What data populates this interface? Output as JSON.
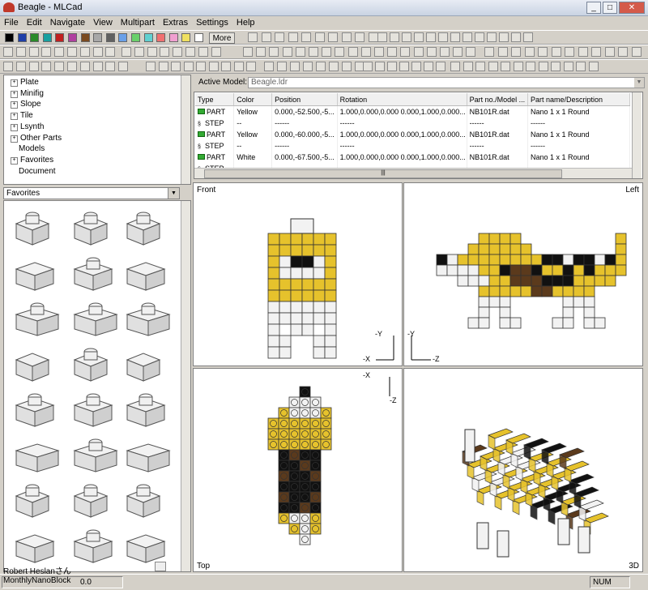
{
  "window": {
    "title": "Beagle - MLCad",
    "controls": [
      "minimize",
      "maximize",
      "close"
    ]
  },
  "menu": [
    "File",
    "Edit",
    "Navigate",
    "View",
    "Multipart",
    "Extras",
    "Settings",
    "Help"
  ],
  "toolbar": {
    "color_swatches": [
      "#000000",
      "#1f3fa8",
      "#2a8a2a",
      "#18a0a0",
      "#c02020",
      "#b040a0",
      "#7a4a20",
      "#a8a8a8",
      "#606060",
      "#6aa0e8",
      "#6ad06a",
      "#60d0d0",
      "#f07070",
      "#f0a0d0",
      "#f0e060",
      "#ffffff"
    ],
    "more_label": "More"
  },
  "tree": {
    "items": [
      {
        "label": "Plate",
        "expandable": true
      },
      {
        "label": "Minifig",
        "expandable": true
      },
      {
        "label": "Slope",
        "expandable": true
      },
      {
        "label": "Tile",
        "expandable": true
      },
      {
        "label": "Lsynth",
        "expandable": true
      },
      {
        "label": "Other Parts",
        "expandable": true
      },
      {
        "label": "Models",
        "expandable": false
      },
      {
        "label": "Favorites",
        "expandable": true
      },
      {
        "label": "Document",
        "expandable": false
      }
    ]
  },
  "favorites_combo": {
    "value": "Favorites"
  },
  "active_model": {
    "label": "Active Model:",
    "value": "Beagle.ldr"
  },
  "parts_table": {
    "columns": [
      "Type",
      "Color",
      "Position",
      "Rotation",
      "Part no./Model ...",
      "Part name/Description"
    ],
    "rows": [
      {
        "type": "PART",
        "color": "Yellow",
        "position": "0.000,-52.500,-5...",
        "rotation": "1.000,0.000,0.000 0.000,1.000,0.000...",
        "part_no": "NB101R.dat",
        "name": "Nano 1 x 1 Round"
      },
      {
        "type": "STEP",
        "color": "--",
        "position": "------",
        "rotation": "------",
        "part_no": "------",
        "name": "------"
      },
      {
        "type": "PART",
        "color": "Yellow",
        "position": "0.000,-60.000,-5...",
        "rotation": "1.000,0.000,0.000 0.000,1.000,0.000...",
        "part_no": "NB101R.dat",
        "name": "Nano 1 x 1 Round"
      },
      {
        "type": "STEP",
        "color": "--",
        "position": "------",
        "rotation": "------",
        "part_no": "------",
        "name": "------"
      },
      {
        "type": "PART",
        "color": "White",
        "position": "0.000,-67.500,-5...",
        "rotation": "1.000,0.000,0.000 0.000,1.000,0.000...",
        "part_no": "NB101R.dat",
        "name": "Nano 1 x 1 Round"
      },
      {
        "type": "STEP",
        "color": "--",
        "position": "------",
        "rotation": "------",
        "part_no": "------",
        "name": "------"
      }
    ]
  },
  "views": {
    "front": {
      "label": "Front",
      "axes": {
        "up": "-Y",
        "side": "-X"
      }
    },
    "left": {
      "label": "Left",
      "axes": {
        "up": "-Y",
        "side": "-Z"
      }
    },
    "top": {
      "label": "Top",
      "axes": {
        "side": "-X",
        "down": "-Z"
      }
    },
    "threed": {
      "label": "3D"
    }
  },
  "palette": {
    "yellow": "#e6c22c",
    "black": "#111111",
    "brown": "#5b3a1c",
    "white": "#f2f2f2"
  },
  "status": {
    "zoom_text": "0.0",
    "num": "NUM"
  },
  "watermark": {
    "line1": "Robert Heslanさん",
    "line2": "MonthlyNanoBlock"
  }
}
